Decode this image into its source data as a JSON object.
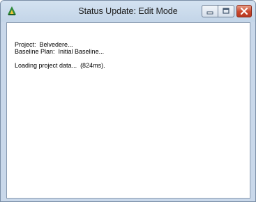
{
  "window": {
    "title": "Status Update:  Edit Mode",
    "icon": "app-icon"
  },
  "controls": {
    "minimize_icon": "minimize-icon",
    "maximize_icon": "maximize-icon",
    "close_icon": "close-icon"
  },
  "log": {
    "project_line": "Project:  Belvedere...",
    "baseline_line": "Baseline Plan:  Initial Baseline...",
    "loading_line": "Loading project data...  (824ms)."
  },
  "colors": {
    "titlebar": "#c3d5e8",
    "close_button": "#c9472c",
    "client_background": "#ffffff"
  }
}
